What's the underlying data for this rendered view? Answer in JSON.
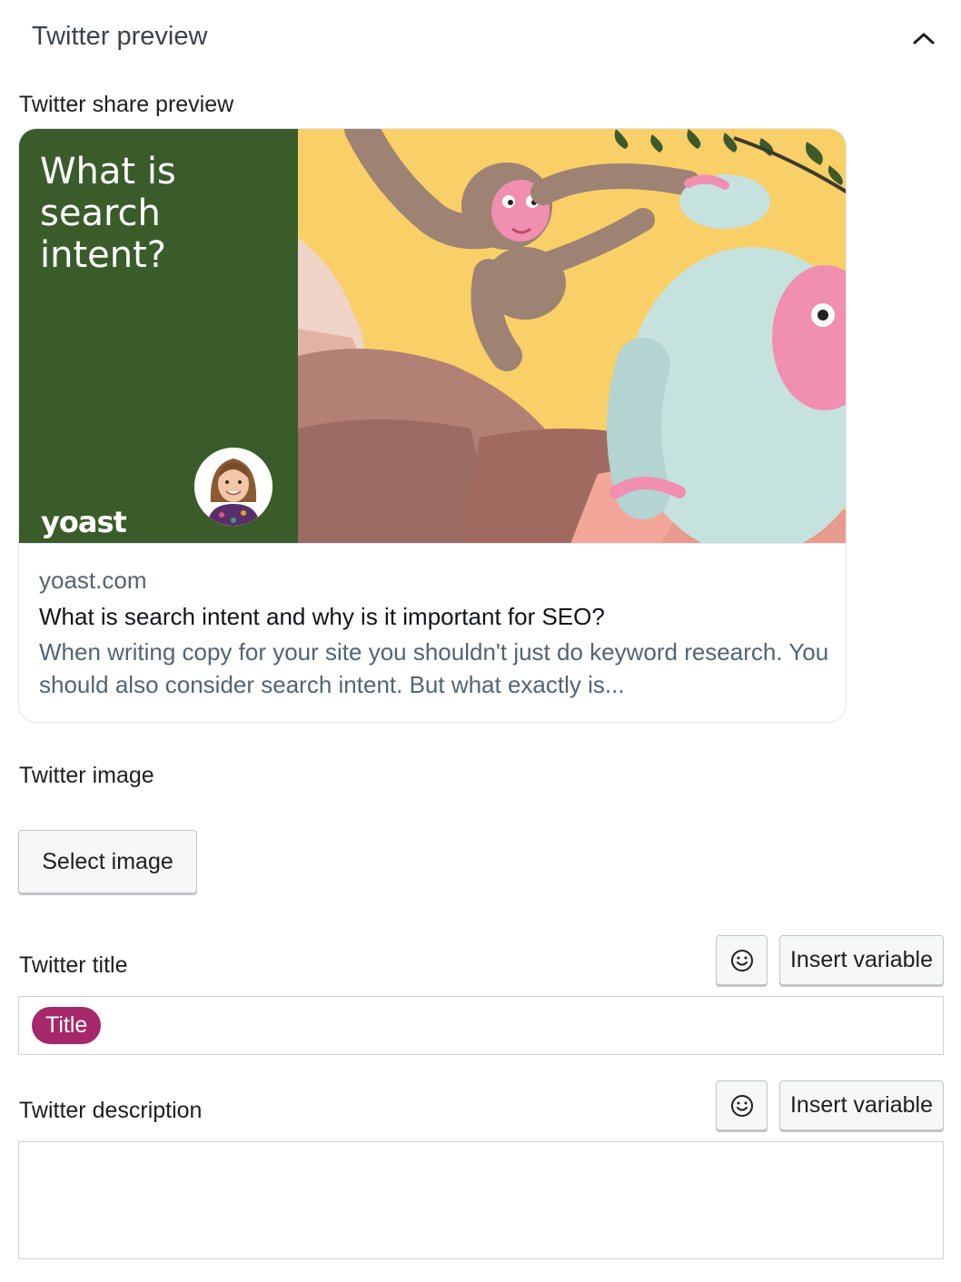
{
  "panel": {
    "title": "Twitter preview",
    "collapse_icon": "chevron-up-icon"
  },
  "preview": {
    "label": "Twitter share preview",
    "image": {
      "headline": "What is search intent?",
      "brand": "yoast"
    },
    "domain": "yoast.com",
    "title": "What is search intent and why is it important for SEO?",
    "description": "When writing copy for your site you shouldn't just do keyword research. You should also consider search intent. But what exactly is..."
  },
  "twitter_image": {
    "label": "Twitter image",
    "button_label": "Select image"
  },
  "twitter_title": {
    "label": "Twitter title",
    "emoji_icon": "smiley-icon",
    "insert_variable_label": "Insert variable",
    "variable_pill": "Title"
  },
  "twitter_description": {
    "label": "Twitter description",
    "emoji_icon": "smiley-icon",
    "insert_variable_label": "Insert variable",
    "value": ""
  },
  "colors": {
    "pill": "#a4286a",
    "image_panel": "#3a5c2a",
    "muted_text": "#536471"
  }
}
